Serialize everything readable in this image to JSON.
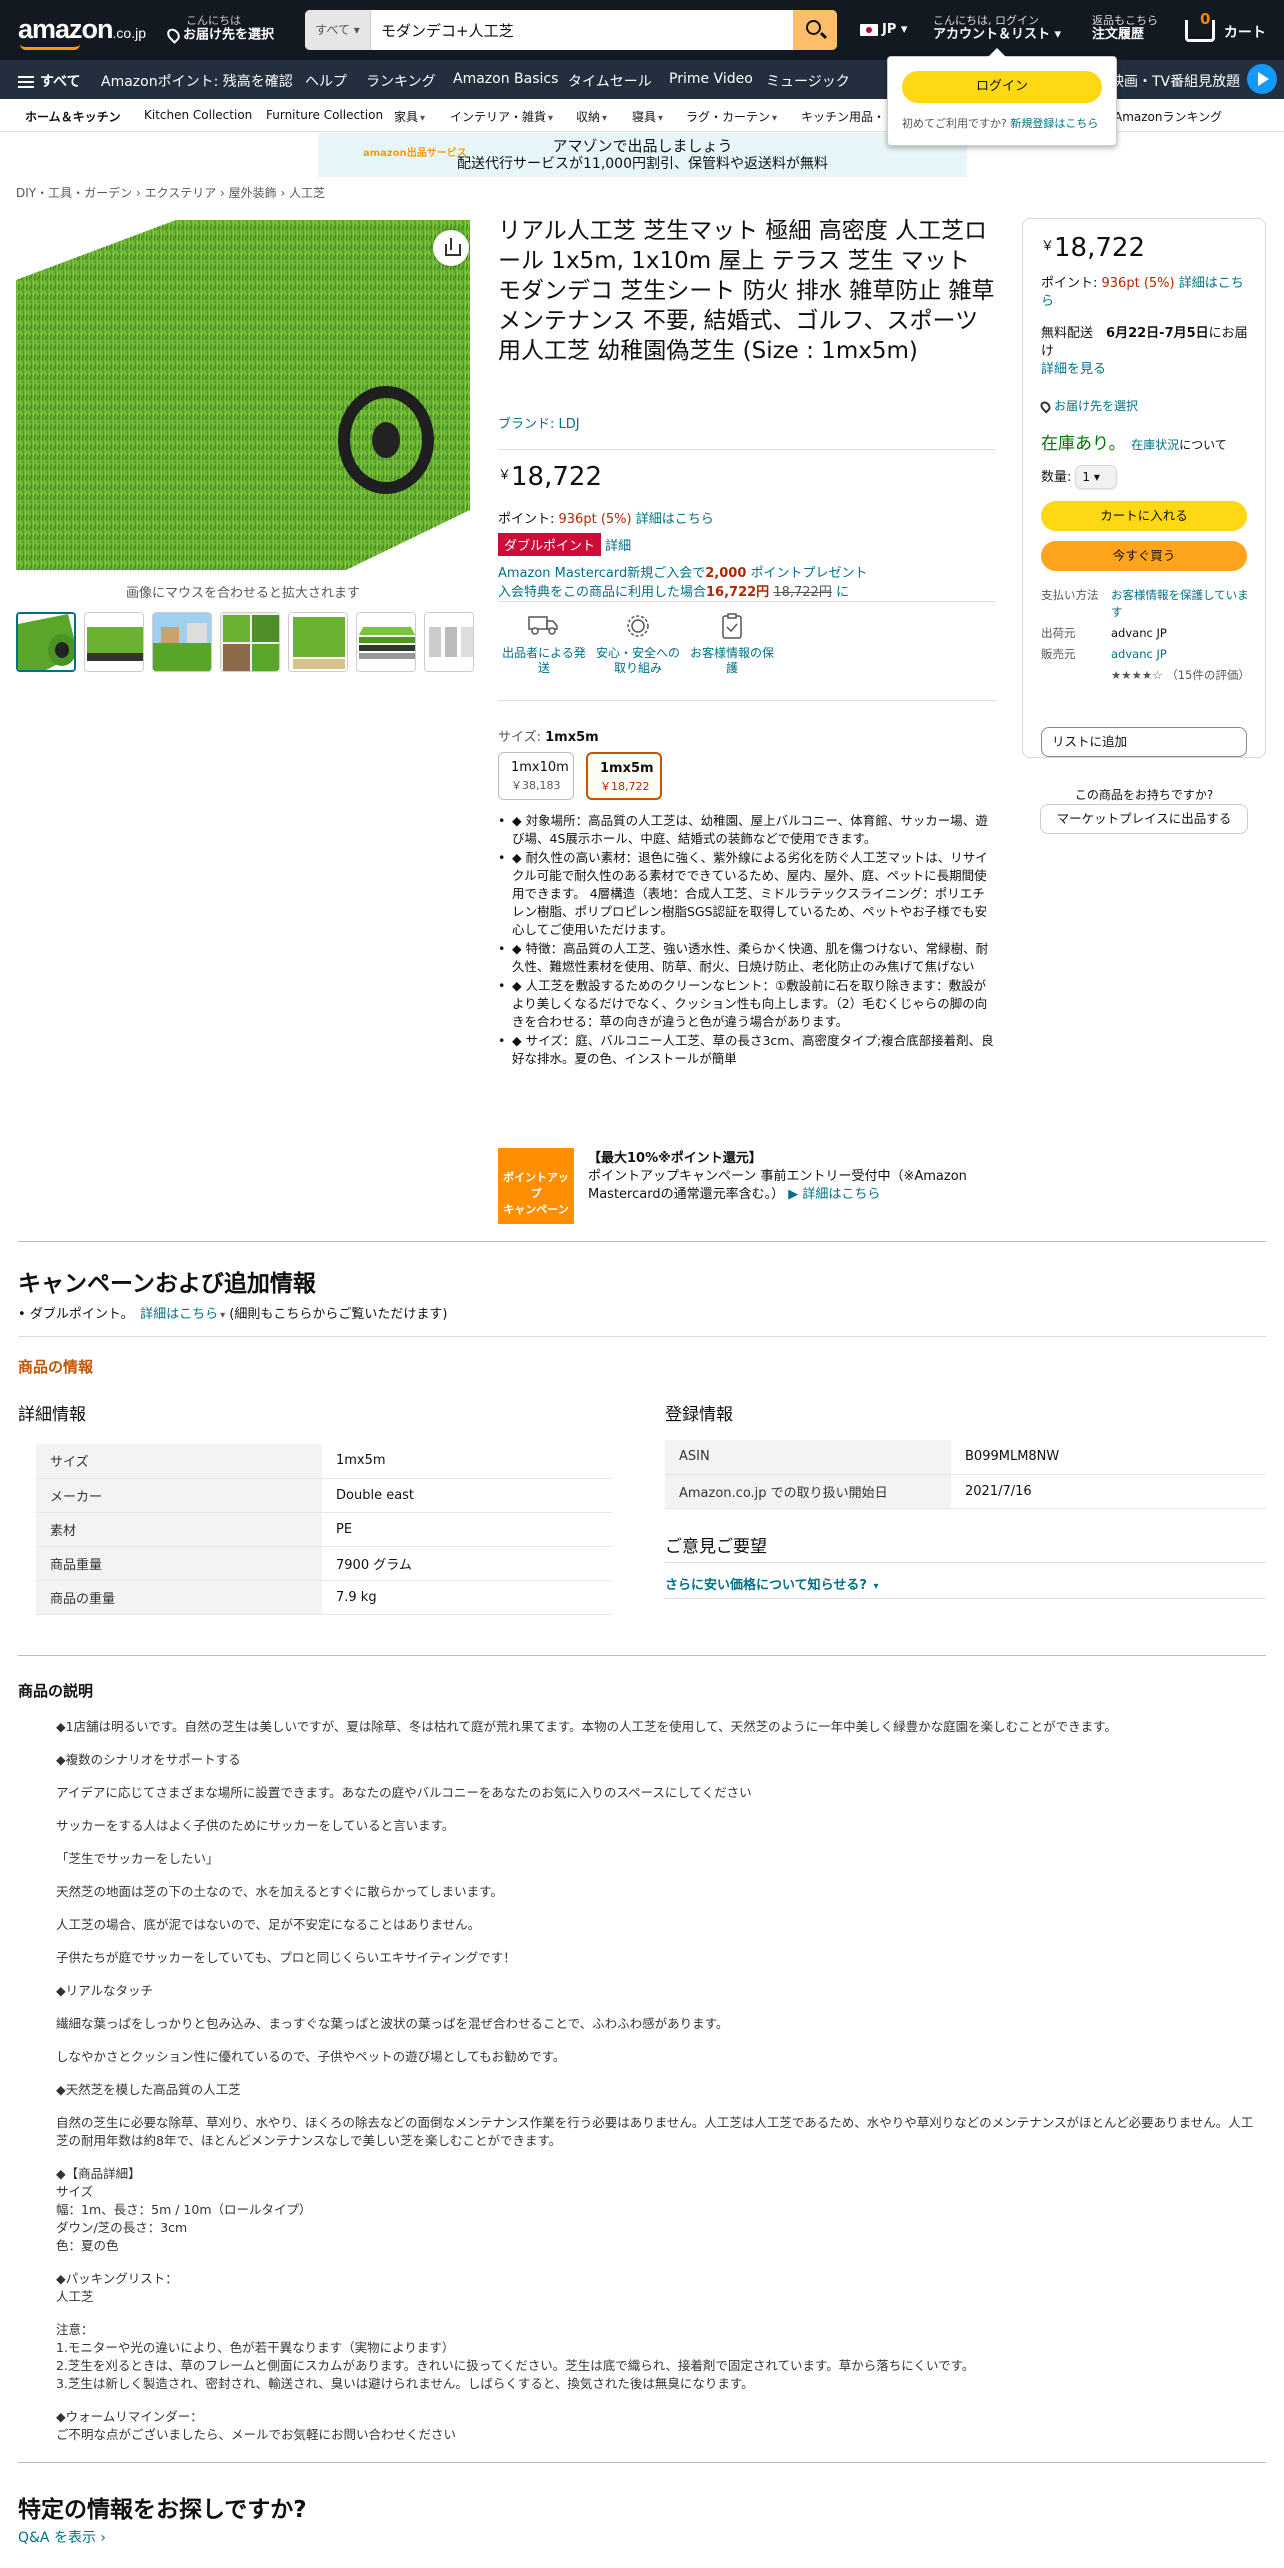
{
  "header": {
    "logo_main": "amazon",
    "logo_suffix": ".co.jp",
    "deliver_line1": "こんにちは",
    "deliver_line2": "お届け先を選択",
    "search_category": "すべて",
    "search_value": "モダンデコ+人工芝",
    "lang": "JP",
    "account_line1": "こんにちは, ログイン",
    "account_line2": "アカウント＆リスト",
    "orders_line1": "返品もこちら",
    "orders_line2": "注文履歴",
    "cart_count": "0",
    "cart_label": "カート"
  },
  "nav": {
    "all": "すべて",
    "items": [
      "Amazonポイント: 残高を確認",
      "ヘルプ",
      "ランキング",
      "Amazon Basics",
      "タイムセール",
      "Prime Video",
      "ミュージック"
    ],
    "right": "映画・TV番組見放題"
  },
  "subnav": {
    "items": [
      "ホーム＆キッチン",
      "Kitchen Collection",
      "Furniture Collection",
      "家具",
      "インテリア・雑貨",
      "収納",
      "寝具",
      "ラグ・カーテン",
      "キッチン用品・",
      "Amazonランキング"
    ]
  },
  "signin_popover": {
    "button": "ログイン",
    "new_customer": "初めてご利用ですか?",
    "new_customer_link": "新規登録はこちら"
  },
  "banner": {
    "logo": "amazon",
    "logo_sub": "出品サービス",
    "line1": "アマゾンで出品しましょう",
    "line2": "配送代行サービスが11,000円割引、保管料や返送料が無料"
  },
  "breadcrumb": [
    "DIY・工具・ガーデン",
    "エクステリア",
    "屋外装飾",
    "人工芝"
  ],
  "gallery": {
    "zoom_hint": "画像にマウスを合わせると拡大されます",
    "thumb_count": 7
  },
  "product": {
    "title": "リアル人工芝 芝生マット 極細 高密度 人工芝ロール 1x5m, 1x10m 屋上 テラス 芝生 マット モダンデコ 芝生シート 防火 排水 雑草防止 雑草 メンテナンス 不要, 結婚式、ゴルフ、スポーツ用人工芝 幼稚園偽芝生 (Size : 1mx5m)",
    "brand": "ブランド: LDJ",
    "currency": "￥",
    "price": "18,722",
    "points_label": "ポイント: ",
    "points_value": "936pt",
    "points_pct": "(5%)",
    "points_link": "詳細はこちら",
    "double_point": "ダブルポイント",
    "double_point_link": "詳細",
    "mc_line1_a": "Amazon Mastercard新規ご入会で",
    "mc_line1_b": "2,000",
    "mc_line1_c": " ポイントプレゼント",
    "mc_line2_a": "入会特典をこの商品に利用した場合",
    "mc_line2_b": "16,722円",
    "mc_line2_c": "18,722円",
    "mc_line2_d": " に",
    "features": [
      {
        "icon": "truck-icon",
        "label": "出品者による発送"
      },
      {
        "icon": "badge-icon",
        "label": "安心・安全への取り組み"
      },
      {
        "icon": "clipboard-icon",
        "label": "お客様情報の保護"
      }
    ],
    "size_label": "サイズ: ",
    "size_selected": "1mx5m",
    "sizes": [
      {
        "name": "1mx10m",
        "price": "￥38,183"
      },
      {
        "name": "1mx5m",
        "price": "￥18,722"
      }
    ],
    "bullets": [
      "◆ 対象場所：高品質の人工芝は、幼稚園、屋上バルコニー、体育館、サッカー場、遊び場、4S展示ホール、中庭、結婚式の装飾などで使用できます。",
      "◆ 耐久性の高い素材：退色に強く、紫外線による劣化を防ぐ人工芝マットは、リサイクル可能で耐久性のある素材でできているため、屋内、屋外、庭、ペットに長期間使用できます。 4層構造（表地：合成人工芝、ミドルラテックスライニング：ポリエチレン樹脂、ポリプロピレン樹脂SGS認証を取得しているため、ペットやお子様でも安心してご使用いただけます。",
      "◆ 特徴：高品質の人工芝、強い透水性、柔らかく快適、肌を傷つけない、常緑樹、耐久性、難燃性素材を使用、防草、耐火、日焼け防止、老化防止のみ焦げて焦げない",
      "◆ 人工芝を敷設するためのクリーンなヒント：①敷設前に石を取り除きます：敷設がより美しくなるだけでなく、クッション性も向上します。（2）毛むくじゃらの脚の向きを合わせる：草の向きが違うと色が違う場合があります。",
      "◆ サイズ：庭、バルコニー人工芝、草の長さ3cm、高密度タイプ;複合底部接着剤、良好な排水。夏の色、インストールが簡単"
    ],
    "promo_badge_1": "ポイントアップ",
    "promo_badge_2": "キャンペーン",
    "promo_title": "【最大10%※ポイント還元】",
    "promo_text": "ポイントアップキャンペーン 事前エントリー受付中（※Amazon Mastercardの通常還元率含む。）",
    "promo_link": "▶ 詳細はこちら"
  },
  "buybox": {
    "price": "18,722",
    "points_label": "ポイント: ",
    "points_value": "936pt",
    "points_pct": "(5%)",
    "points_link": "詳細はこちら",
    "shipping_a": "無料配送",
    "shipping_b": "6月22日-7月5日",
    "shipping_c": "にお届け",
    "shipping_link": "詳細を見る",
    "location": "お届け先を選択",
    "stock": "在庫あり。",
    "stock_link": "在庫状況",
    "stock_suffix": "について",
    "qty_label": "数量:",
    "qty_value": "1",
    "add_to_cart": "カートに入れる",
    "buy_now": "今すぐ買う",
    "rows": [
      {
        "k": "支払い方法",
        "v": "お客様情報を保護しています",
        "link": true
      },
      {
        "k": "出荷元",
        "v": "advanc JP",
        "link": false
      },
      {
        "k": "販売元",
        "v": "advanc JP",
        "link": true
      },
      {
        "k": "",
        "v": "★★★★☆ （15件の評価）",
        "link": false
      }
    ],
    "add_to_list": "リストに追加",
    "sell_question": "この商品をお持ちですか?",
    "sell_button": "マーケットプレイスに出品する"
  },
  "campaign": {
    "heading": "キャンペーンおよび追加情報",
    "item": "ダブルポイント。",
    "item_link": "詳細はこちら",
    "item_suffix": "(細則もこちらからご覧いただけます)"
  },
  "product_info": {
    "heading": "商品の情報",
    "detail_heading": "詳細情報",
    "details": [
      {
        "k": "サイズ",
        "v": "1mx5m"
      },
      {
        "k": "メーカー",
        "v": "Double east"
      },
      {
        "k": "素材",
        "v": "PE"
      },
      {
        "k": "商品重量",
        "v": "7900 グラム"
      },
      {
        "k": "商品の重量",
        "v": "7.9 kg"
      }
    ],
    "reg_heading": "登録情報",
    "reg": [
      {
        "k": "ASIN",
        "v": "B099MLM8NW"
      },
      {
        "k": "Amazon.co.jp での取り扱い開始日",
        "v": "2021/7/16"
      }
    ],
    "feedback_heading": "ご意見ご要望",
    "feedback_link": "さらに安い価格について知らせる?"
  },
  "description": {
    "heading": "商品の説明",
    "lines": [
      "◆1店舗は明るいです。自然の芝生は美しいですが、夏は除草、冬は枯れて庭が荒れ果てます。本物の人工芝を使用して、天然芝のように一年中美しく緑豊かな庭園を楽しむことができます。",
      "",
      "◆複数のシナリオをサポートする",
      "",
      "アイデアに応じてさまざまな場所に設置できます。あなたの庭やバルコニーをあなたのお気に入りのスペースにしてください",
      "",
      "サッカーをする人はよく子供のためにサッカーをしていると言います。",
      "",
      "「芝生でサッカーをしたい」",
      "",
      "天然芝の地面は芝の下の土なので、水を加えるとすぐに散らかってしまいます。",
      "",
      "人工芝の場合、底が泥ではないので、足が不安定になることはありません。",
      "",
      "子供たちが庭でサッカーをしていても、プロと同じくらいエキサイティングです！",
      "",
      "◆リアルなタッチ",
      "",
      "繊細な葉っぱをしっかりと包み込み、まっすぐな葉っぱと波状の葉っぱを混ぜ合わせることで、ふわふわ感があります。",
      "",
      "しなやかさとクッション性に優れているので、子供やペットの遊び場としてもお勧めです。",
      "",
      "◆天然芝を模した高品質の人工芝",
      "",
      "自然の芝生に必要な除草、草刈り、水やり、ほくろの除去などの面倒なメンテナンス作業を行う必要はありません。人工芝は人工芝であるため、水やりや草刈りなどのメンテナンスがほとんど必要ありません。人工芝の耐用年数は約8年で、ほとんどメンテナンスなしで美しい芝を楽しむことができます。",
      "",
      "◆【商品詳細】",
      "サイズ",
      "幅：1m、長さ：5m / 10m（ロールタイプ）",
      "ダウン/芝の長さ：3cm",
      "色：夏の色",
      "",
      "◆パッキングリスト：",
      "人工芝",
      "",
      "注意：",
      "1.モニターや光の違いにより、色が若干異なります（実物によります）",
      "2.芝生を刈るときは、草のフレームと側面にスカムがあります。きれいに扱ってください。芝生は底で織られ、接着剤で固定されています。草から落ちにくいです。",
      "3.芝生は新しく製造され、密封され、輸送され、臭いは避けられません。しばらくすると、換気された後は無臭になります。",
      "",
      "◆ウォームリマインダー：",
      "ご不明な点がございましたら、メールでお気軽にお問い合わせください"
    ]
  },
  "qa": {
    "heading": "特定の情報をお探しですか?",
    "link": "Q&A を表示 ›"
  }
}
